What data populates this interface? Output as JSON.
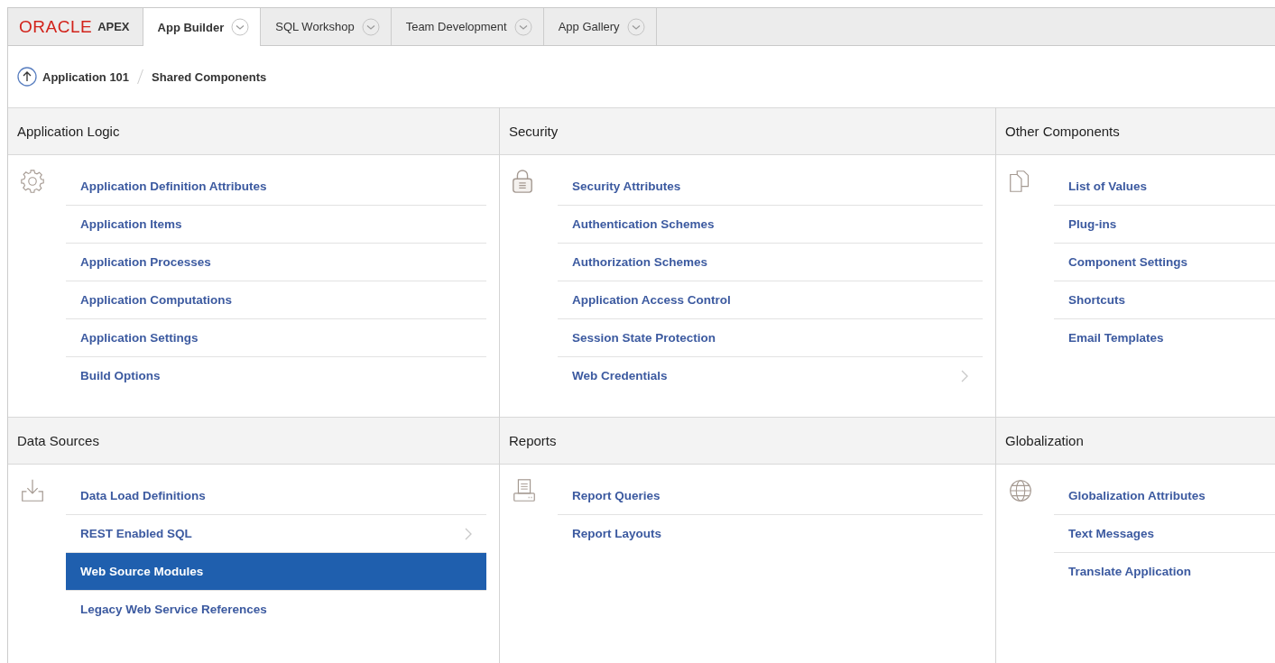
{
  "brand": {
    "vendor": "ORACLE",
    "product": "APEX"
  },
  "tabs": [
    {
      "label": "App Builder",
      "selected": true
    },
    {
      "label": "SQL Workshop",
      "selected": false
    },
    {
      "label": "Team Development",
      "selected": false
    },
    {
      "label": "App Gallery",
      "selected": false
    }
  ],
  "breadcrumb": {
    "parent": "Application 101",
    "current": "Shared Components"
  },
  "panels": [
    {
      "title": "Application Logic",
      "items": [
        {
          "label": "Application Definition Attributes",
          "selected": false,
          "has_submenu": false
        },
        {
          "label": "Application Items",
          "selected": false,
          "has_submenu": false
        },
        {
          "label": "Application Processes",
          "selected": false,
          "has_submenu": false
        },
        {
          "label": "Application Computations",
          "selected": false,
          "has_submenu": false
        },
        {
          "label": "Application Settings",
          "selected": false,
          "has_submenu": false
        },
        {
          "label": "Build Options",
          "selected": false,
          "has_submenu": false
        }
      ]
    },
    {
      "title": "Security",
      "items": [
        {
          "label": "Security Attributes",
          "selected": false,
          "has_submenu": false
        },
        {
          "label": "Authentication Schemes",
          "selected": false,
          "has_submenu": false
        },
        {
          "label": "Authorization Schemes",
          "selected": false,
          "has_submenu": false
        },
        {
          "label": "Application Access Control",
          "selected": false,
          "has_submenu": false
        },
        {
          "label": "Session State Protection",
          "selected": false,
          "has_submenu": false
        },
        {
          "label": "Web Credentials",
          "selected": false,
          "has_submenu": true
        }
      ]
    },
    {
      "title": "Other Components",
      "items": [
        {
          "label": "List of Values",
          "selected": false,
          "has_submenu": false
        },
        {
          "label": "Plug-ins",
          "selected": false,
          "has_submenu": false
        },
        {
          "label": "Component Settings",
          "selected": false,
          "has_submenu": false
        },
        {
          "label": "Shortcuts",
          "selected": false,
          "has_submenu": false
        },
        {
          "label": "Email Templates",
          "selected": false,
          "has_submenu": false
        }
      ]
    },
    {
      "title": "Data Sources",
      "items": [
        {
          "label": "Data Load Definitions",
          "selected": false,
          "has_submenu": false
        },
        {
          "label": "REST Enabled SQL",
          "selected": false,
          "has_submenu": true
        },
        {
          "label": "Web Source Modules",
          "selected": true,
          "has_submenu": false
        },
        {
          "label": "Legacy Web Service References",
          "selected": false,
          "has_submenu": false
        }
      ]
    },
    {
      "title": "Reports",
      "items": [
        {
          "label": "Report Queries",
          "selected": false,
          "has_submenu": false
        },
        {
          "label": "Report Layouts",
          "selected": false,
          "has_submenu": false
        }
      ]
    },
    {
      "title": "Globalization",
      "items": [
        {
          "label": "Globalization Attributes",
          "selected": false,
          "has_submenu": false
        },
        {
          "label": "Text Messages",
          "selected": false,
          "has_submenu": false
        },
        {
          "label": "Translate Application",
          "selected": false,
          "has_submenu": false
        }
      ]
    }
  ]
}
